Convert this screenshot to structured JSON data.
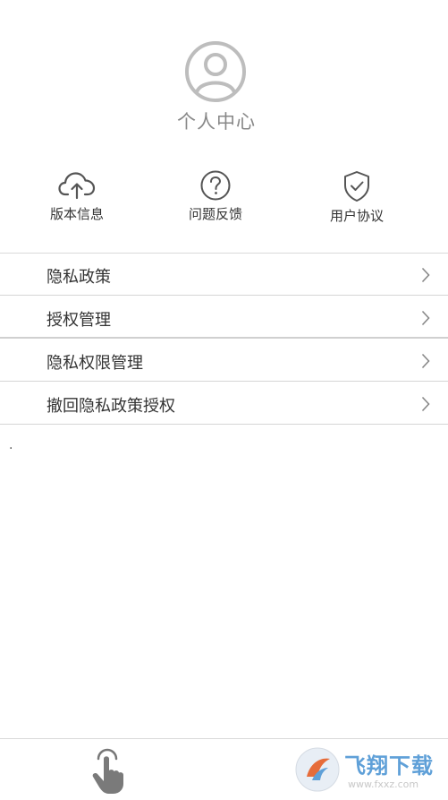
{
  "profile": {
    "title": "个人中心"
  },
  "quick_actions": [
    {
      "label": "版本信息",
      "icon": "cloud-upload-icon"
    },
    {
      "label": "问题反馈",
      "icon": "question-circle-icon"
    },
    {
      "label": "用户协议",
      "icon": "shield-check-icon"
    }
  ],
  "menu": [
    {
      "label": "隐私政策"
    },
    {
      "label": "授权管理"
    },
    {
      "label": "隐私权限管理"
    },
    {
      "label": "撤回隐私政策授权"
    }
  ],
  "stray_text": ".",
  "tabbar": {
    "icon": "hand-tap-icon"
  },
  "watermark": {
    "title": "飞翔下载",
    "url": "www.fxxz.com"
  },
  "colors": {
    "icon_gray": "#555555",
    "avatar_gray": "#bdbdbd",
    "divider": "#d9d9d9",
    "watermark_blue": "#5fa0d8"
  }
}
